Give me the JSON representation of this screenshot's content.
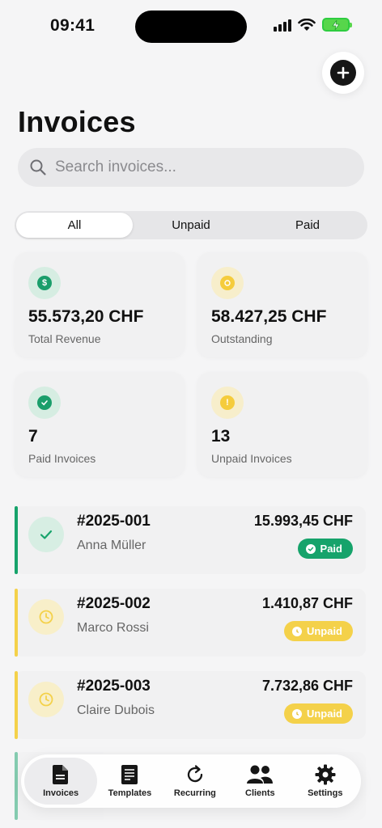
{
  "status_bar": {
    "time": "09:41"
  },
  "header": {
    "title": "Invoices",
    "add_icon": "plus-icon"
  },
  "search": {
    "placeholder": "Search invoices..."
  },
  "filter_tabs": [
    {
      "label": "All",
      "active": true
    },
    {
      "label": "Unpaid",
      "active": false
    },
    {
      "label": "Paid",
      "active": false
    }
  ],
  "stats": [
    {
      "value": "55.573,20 CHF",
      "label": "Total Revenue",
      "icon": "dollar-icon",
      "color": "#1a9e6b"
    },
    {
      "value": "58.427,25 CHF",
      "label": "Outstanding",
      "icon": "clock-icon",
      "color": "#f5cc3c"
    },
    {
      "value": "7",
      "label": "Paid Invoices",
      "icon": "check-icon",
      "color": "#1a9e6b"
    },
    {
      "value": "13",
      "label": "Unpaid Invoices",
      "icon": "alert-icon",
      "color": "#f5cc3c"
    }
  ],
  "invoices": [
    {
      "number": "#2025-001",
      "client": "Anna Müller",
      "amount": "15.993,45 CHF",
      "status": "Paid"
    },
    {
      "number": "#2025-002",
      "client": "Marco Rossi",
      "amount": "1.410,87 CHF",
      "status": "Unpaid"
    },
    {
      "number": "#2025-003",
      "client": "Claire Dubois",
      "amount": "7.732,86 CHF",
      "status": "Unpaid"
    }
  ],
  "tabbar": [
    {
      "label": "Invoices",
      "icon": "document-icon",
      "active": true
    },
    {
      "label": "Templates",
      "icon": "template-icon",
      "active": false
    },
    {
      "label": "Recurring",
      "icon": "refresh-icon",
      "active": false
    },
    {
      "label": "Clients",
      "icon": "people-icon",
      "active": false
    },
    {
      "label": "Settings",
      "icon": "gear-icon",
      "active": false
    }
  ],
  "colors": {
    "paid": "#16a36b",
    "unpaid": "#f4d14a",
    "paid_bg": "#d7eee3",
    "unpaid_bg": "#f8efc9"
  }
}
